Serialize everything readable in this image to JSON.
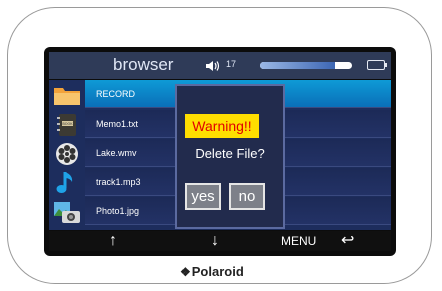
{
  "app": {
    "title": "browser"
  },
  "volume": {
    "level": 17,
    "level_label": "17",
    "fill_fraction": 0.82
  },
  "files": [
    {
      "name": "RECORD",
      "icon": "folder-icon",
      "selected": true
    },
    {
      "name": "Memo1.txt",
      "icon": "book-icon",
      "selected": false
    },
    {
      "name": "Lake.wmv",
      "icon": "film-reel-icon",
      "selected": false
    },
    {
      "name": "track1.mp3",
      "icon": "music-note-icon",
      "selected": false
    },
    {
      "name": "Photo1.jpg",
      "icon": "camera-photo-icon",
      "selected": false
    }
  ],
  "dialog": {
    "warning": "Warning!!",
    "message": "Delete File?",
    "yes_label": "yes",
    "no_label": "no"
  },
  "bottom_bar": {
    "up_label": "↑",
    "down_label": "↓",
    "menu_label": "MENU",
    "back_label": "↩"
  },
  "brand": {
    "name": "Polaroid",
    "mark": "❖"
  },
  "colors": {
    "title_bar": "#2f3b58",
    "list_bg": "#1d2d5d",
    "selected_row": "#0e9ad6",
    "warning_bg": "#ffde00",
    "warning_text": "#e10000"
  }
}
